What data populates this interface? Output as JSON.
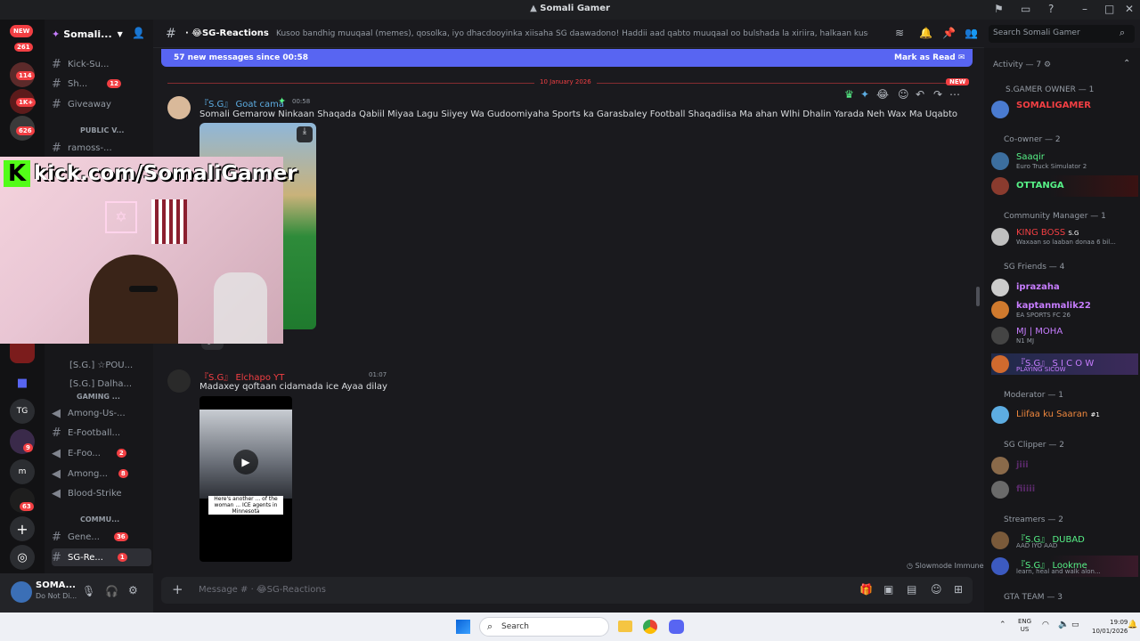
{
  "window": {
    "title": "Somali Gamer"
  },
  "server": {
    "name": "Somali...",
    "new_badge": "NEW",
    "badge_261": "261"
  },
  "rail": {
    "badges": [
      "114",
      "1K+",
      "626",
      "9",
      "63"
    ],
    "tg_label": "TG",
    "m_label": "m"
  },
  "channels": {
    "items": [
      {
        "label": "Kick-Su..."
      },
      {
        "label": "Sh...",
        "badge": "12"
      },
      {
        "label": "Giveaway"
      },
      {
        "label": "ramoss-..."
      },
      {
        "label": "[S.G.] ☆POU..."
      },
      {
        "label": "[S.G.] Dalha..."
      },
      {
        "label": "Among-Us-..."
      },
      {
        "label": "E-Football..."
      },
      {
        "label": "E-Foo...",
        "badge": "2"
      },
      {
        "label": "Among...",
        "badge": "8"
      },
      {
        "label": "Blood-Strike"
      },
      {
        "label": "Gene...",
        "badge": "36"
      },
      {
        "label": "SG-Re...",
        "badge": "1"
      }
    ],
    "categories": [
      "PUBLIC V...",
      "GAMING ...",
      "COMMU..."
    ]
  },
  "user": {
    "name": "SOMA...",
    "status": "Do Not Di..."
  },
  "header": {
    "channel": "SG-Reactions",
    "topic": "Kusoo bandhig muuqaal (memes), qosolka, iyo dhacdooyinka xiisaha SG daawadono! Haddii aad qabto muuqaal oo bulshada la xiriira, halkaan kusoo qor oo nala qosol.",
    "search_placeholder": "Search Somali Gamer"
  },
  "banner": {
    "text": "57 new messages since 00:58",
    "mark_read": "Mark as Read"
  },
  "date_divider": "10 January 2026",
  "new_pill": "NEW",
  "messages": [
    {
      "author": "『S.G』 Goat cama",
      "time": "00:58",
      "text": "Somali Gemarow Ninkaan Shaqada Qabiil Miyaa Lagu Siiyey Wa Gudoomiyaha Sports ka Garasbaley Football Shaqadiisa Ma ahan Wlhi Dhalin Yarada Neh Wax Ma Uqabto",
      "reaction_count": "2"
    },
    {
      "author": "『S.G』 Elchapo YT",
      "time": "01:07",
      "text": "Madaxey qoftaan cidamada ice Ayaa dilay",
      "video_caption": "Here's another ... of the woman ... ICE agents in Minnesota"
    }
  ],
  "stream_overlay": {
    "url": "kick.com/SomaliGamer",
    "logo": "K"
  },
  "slowmode": "Slowmode Immune",
  "input": {
    "placeholder": "Message # · 😂SG-Reactions"
  },
  "members": {
    "activity": "Activity — 7",
    "groups": [
      {
        "title": "S.GAMER OWNER — 1",
        "members": [
          {
            "name": "SOMALIGAMER",
            "color": "#f23f43"
          }
        ]
      },
      {
        "title": "Co-owner — 2",
        "members": [
          {
            "name": "Saaqir",
            "sub": "Euro Truck Simulator 2",
            "color": "#57f287"
          },
          {
            "name": "OTTANGA",
            "color": "#57f287"
          }
        ]
      },
      {
        "title": "Community Manager — 1",
        "members": [
          {
            "name": "KING BOSS",
            "sub": "Waxaan so laaban donaa 6 bil...",
            "tag": "S.G",
            "color": "#f23f43"
          }
        ]
      },
      {
        "title": "SG Friends — 4",
        "members": [
          {
            "name": "iprazaha",
            "color": "#c77dff"
          },
          {
            "name": "kaptanmalik22",
            "sub": "EA SPORTS FC 26",
            "color": "#c77dff"
          },
          {
            "name": "MJ | MOHA",
            "sub": "N1 MJ",
            "color": "#c77dff"
          },
          {
            "name": "『S.G』 S I C O W",
            "sub": "PLAYING SICOW",
            "color": "#c77dff"
          }
        ]
      },
      {
        "title": "Moderator — 1",
        "members": [
          {
            "name": "Liifaa ku Saaran",
            "tag": "#1",
            "color": "#f0883e"
          }
        ]
      },
      {
        "title": "SG Clipper — 2",
        "members": [
          {
            "name": "jiii",
            "color": "#9b59b6"
          },
          {
            "name": "fiiiii",
            "color": "#9b59b6"
          }
        ]
      },
      {
        "title": "Streamers — 2",
        "members": [
          {
            "name": "『S.G』 DUBAD",
            "sub": "AAD IYO AAD",
            "color": "#57f287"
          },
          {
            "name": "『S.G』 Lookme",
            "sub": "learn, heal and walk alon...",
            "color": "#57f287"
          }
        ]
      },
      {
        "title": "GTA TEAM — 3",
        "members": []
      }
    ]
  },
  "taskbar": {
    "search": "Search",
    "lang": "ENG",
    "region": "US",
    "time": "19:09",
    "date": "10/01/2026"
  },
  "colors": {
    "accent": "#5865f2",
    "danger": "#f23f43",
    "bg": "#1a1a1e"
  }
}
